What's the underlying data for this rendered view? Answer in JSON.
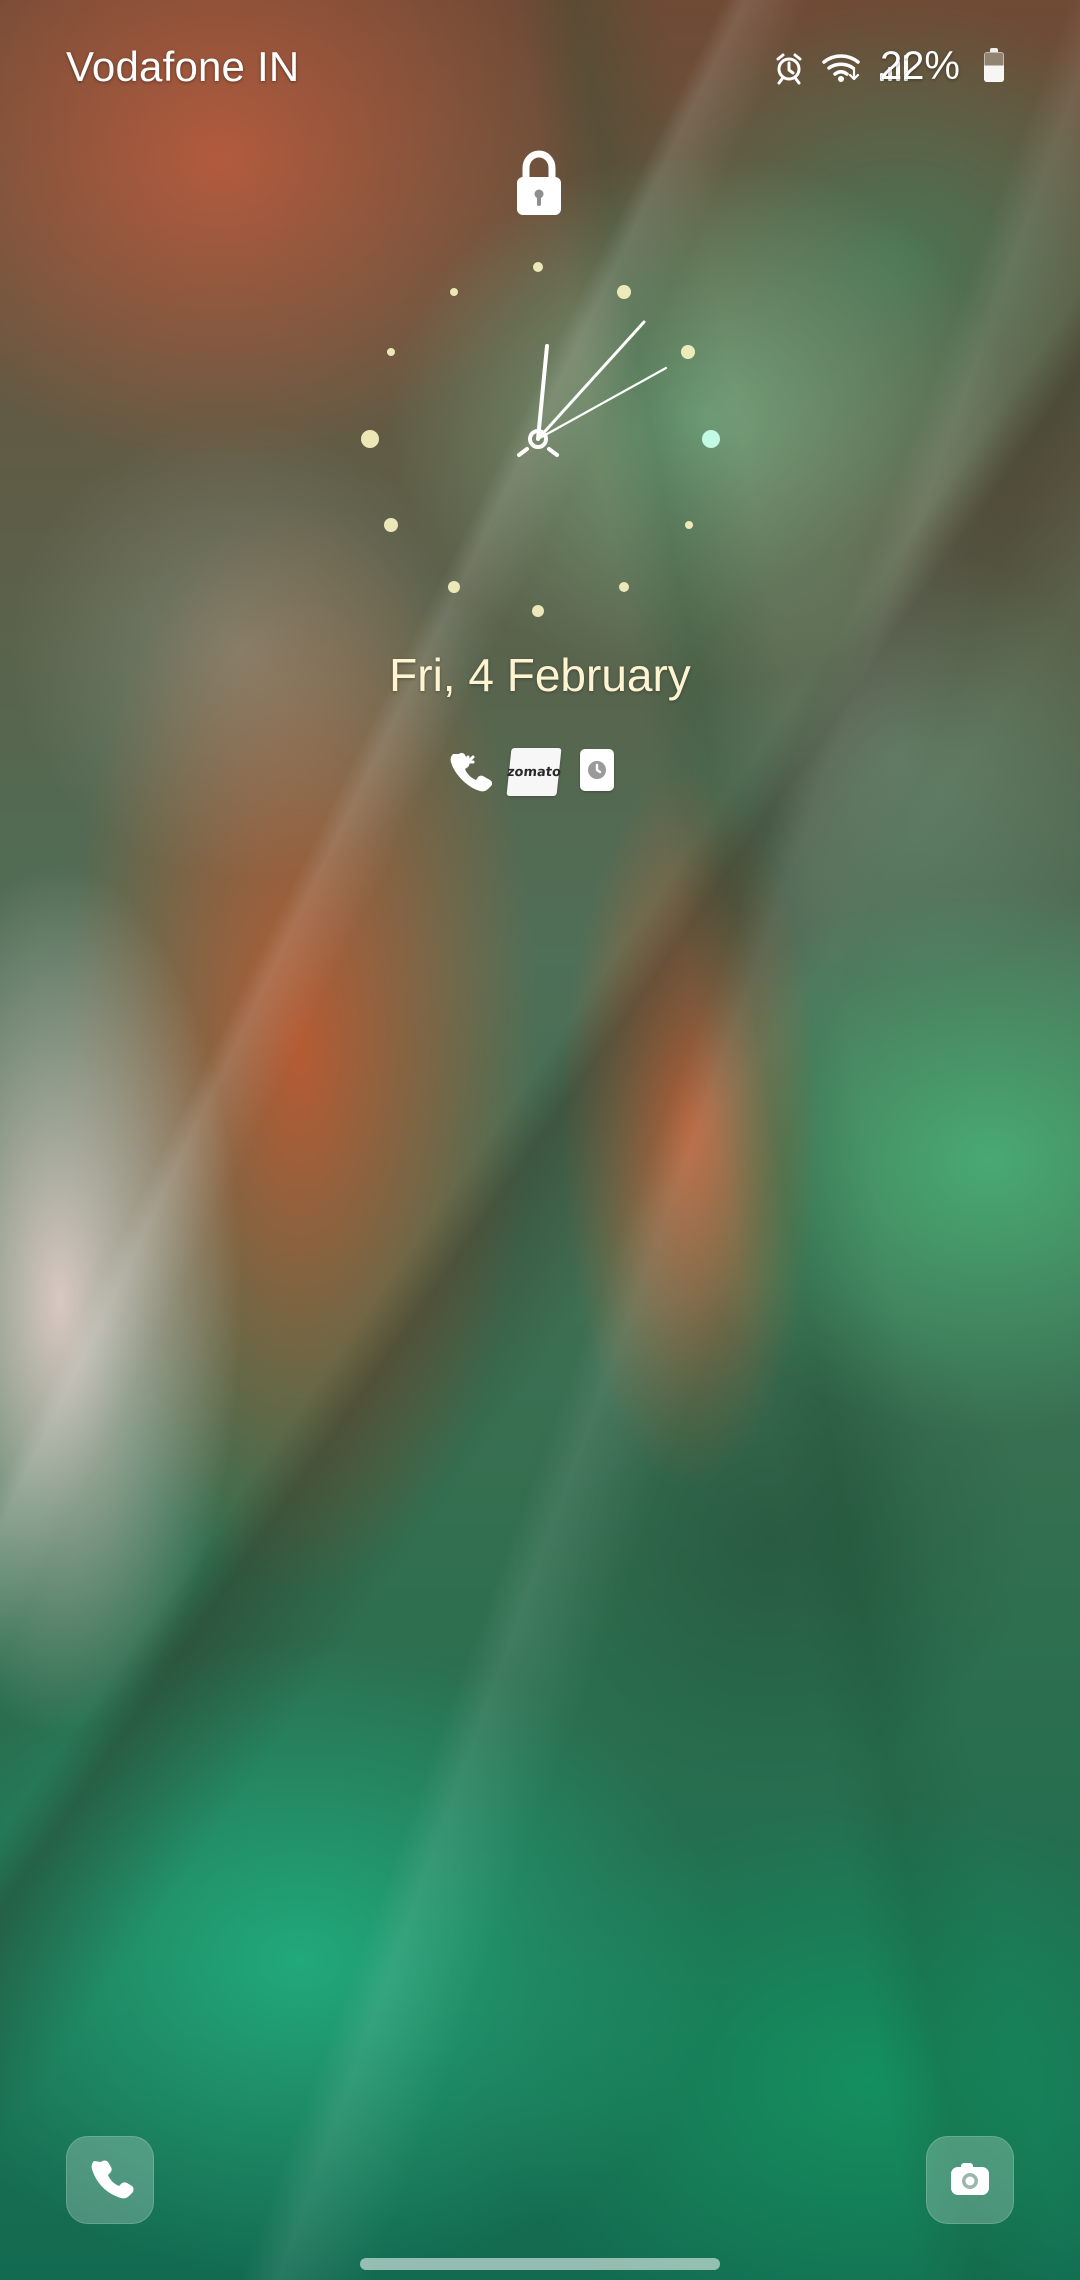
{
  "status_bar": {
    "carrier": "Vodafone IN",
    "battery_percent": "22%",
    "icons": [
      "alarm-icon",
      "wifi-icon",
      "signal-icon",
      "battery-icon"
    ]
  },
  "lockscreen": {
    "date": "Fri, 4 February",
    "clock_style": "analog-dot-clock"
  },
  "notifications": {
    "icons": [
      "missed-call-icon",
      "zomato-app-icon",
      "clock-app-icon"
    ],
    "zomato_label": "zomato"
  },
  "shortcuts": {
    "left": "phone-icon",
    "right": "camera-icon"
  },
  "colors": {
    "clock_dot": "#f4efbf",
    "accent_green": "#b8ffe2",
    "text": "#ffffff"
  }
}
